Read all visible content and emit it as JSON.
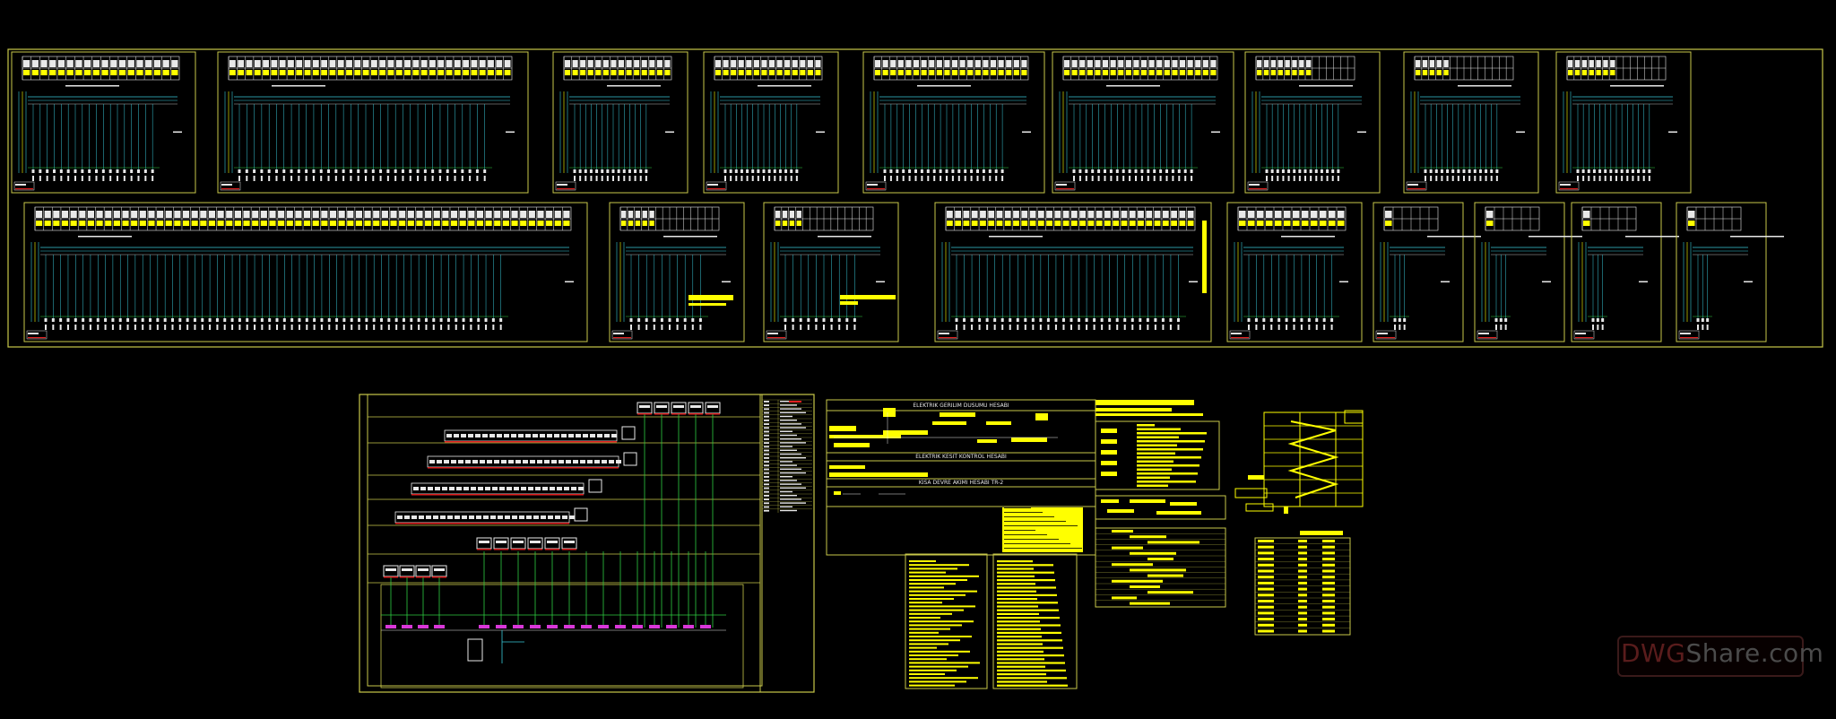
{
  "watermark": {
    "part1": "DWG",
    "part2": "Share.com"
  },
  "colors": {
    "frame": "#c8c84a",
    "yellow": "#ffff00",
    "cyan": "#38c8d8",
    "green": "#2ecc40",
    "magenta": "#d838d8",
    "red": "#e02020",
    "white": "#e8e8e8"
  },
  "drawing_labels": {
    "calc_title_1": "ELEKTRIK GERILIM DUSUMU HESABI",
    "calc_title_2": "ELEKTRIK KESIT KONTROL HESABI",
    "calc_title_3": "KISA DEVRE AKIMI HESABI TR-2"
  }
}
